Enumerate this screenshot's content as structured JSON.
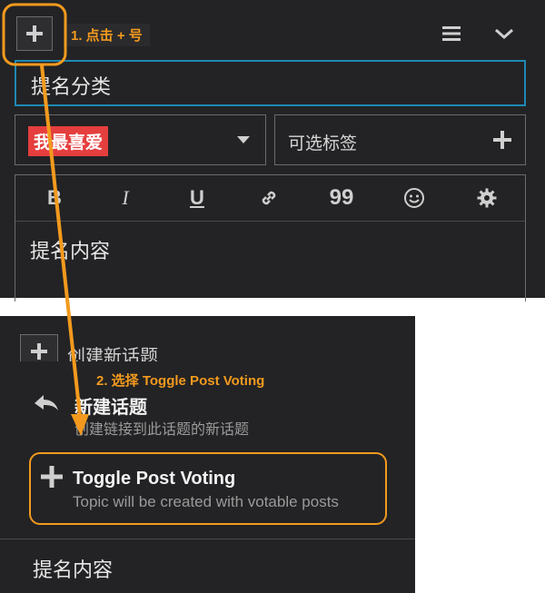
{
  "top": {
    "step1": "1. 点击 + 号",
    "title_placeholder": "提名分类",
    "category": "我最喜爱",
    "tags_placeholder": "可选标签",
    "toolbar": {
      "bold": "B",
      "italic": "I",
      "underline": "U",
      "quote": "99"
    },
    "body_placeholder": "提名内容"
  },
  "bottom": {
    "header_label": "创建新话题",
    "step2": "2. 选择 Toggle Post Voting",
    "menu_items": [
      {
        "title": "新建话题",
        "desc": "创建链接到此话题的新话题"
      },
      {
        "title": "Toggle Post Voting",
        "desc": "Topic will be created with votable posts"
      }
    ],
    "body_placeholder": "提名内容"
  },
  "colors": {
    "accent_orange": "#f39a1e",
    "focus_blue": "#1e88b4",
    "badge_red": "#e53e3e",
    "panel_bg": "#232325"
  }
}
